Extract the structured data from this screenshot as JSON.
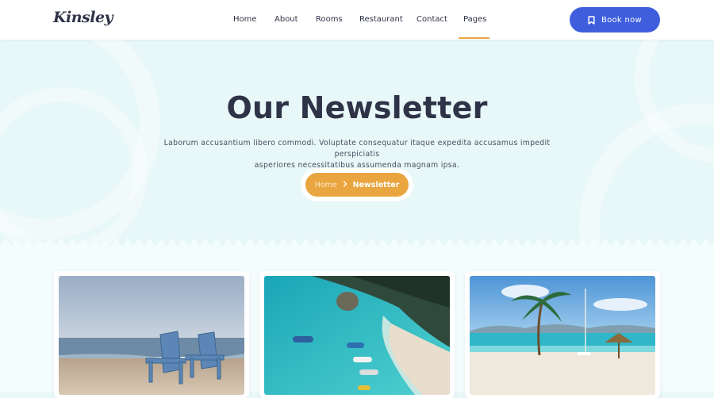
{
  "header": {
    "logo": "Kinsley",
    "nav": [
      {
        "label": "Home"
      },
      {
        "label": "About"
      },
      {
        "label": "Rooms"
      },
      {
        "label": "Restaurant"
      },
      {
        "label": "Contact"
      },
      {
        "label": "Pages",
        "active": true
      }
    ],
    "book_button": {
      "label": "Book now",
      "icon": "bookmark-icon"
    }
  },
  "hero": {
    "title": "Our Newsletter",
    "description_line1": "Laborum accusantium libero commodi. Voluptate consequatur itaque expedita accusamus impedit perspiciatis",
    "description_line2": "asperiores necessitatibus assumenda magnam ipsa.",
    "breadcrumb": {
      "home": "Home",
      "separator_icon": "chevron-right-icon",
      "current": "Newsletter"
    }
  },
  "cards": [
    {
      "image": "beach-chairs-photo"
    },
    {
      "image": "aerial-boats-photo"
    },
    {
      "image": "palm-beach-photo"
    }
  ],
  "colors": {
    "accent": "#e9a53f",
    "primary": "#3f5ede",
    "text": "#2f3347",
    "hero_bg": "#e8f7f7"
  }
}
